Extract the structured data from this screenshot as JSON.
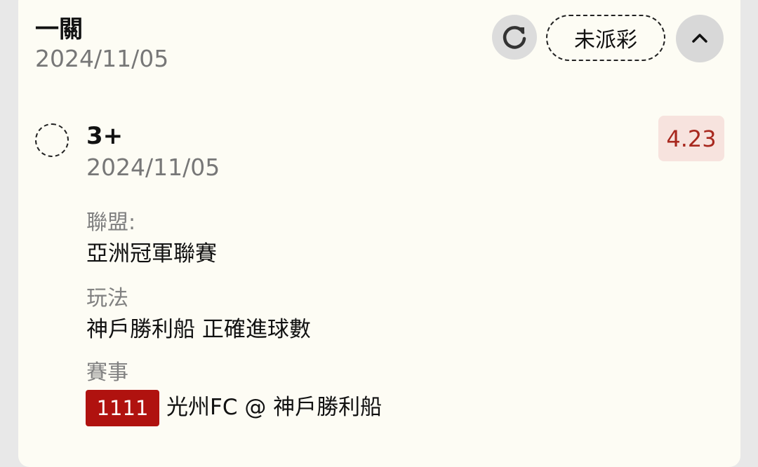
{
  "header": {
    "title": "一關",
    "date": "2024/11/05",
    "status": "未派彩",
    "refresh_icon": "refresh-icon",
    "collapse_icon": "chevron-up-icon"
  },
  "selection": {
    "label": "3+",
    "date": "2024/11/05",
    "odds": "4.23"
  },
  "details": {
    "league_label": "聯盟:",
    "league_value": "亞洲冠軍聯賽",
    "bet_type_label": "玩法",
    "bet_type_value": "神戶勝利船 正確進球數",
    "event_label": "賽事",
    "event_id": "1111",
    "event_match": "光州FC @ 神戶勝利船"
  },
  "colors": {
    "accent_red": "#b0120f",
    "odds_text": "#a8281e",
    "odds_bg": "#f7e3de",
    "card_bg": "#fdfcf4"
  }
}
